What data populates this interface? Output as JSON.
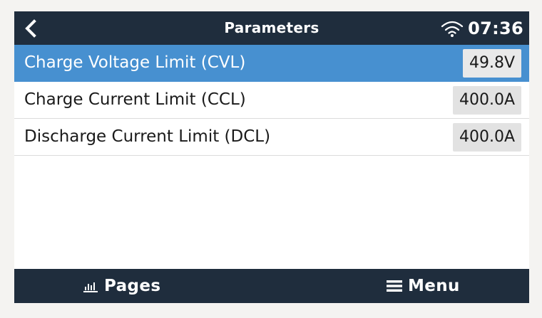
{
  "header": {
    "title": "Parameters",
    "time": "07:36",
    "icons": [
      "back-chevron-icon",
      "wifi-icon"
    ]
  },
  "parameters": [
    {
      "label": "Charge Voltage Limit (CVL)",
      "value": "49.8V",
      "selected": true
    },
    {
      "label": "Charge Current Limit (CCL)",
      "value": "400.0A",
      "selected": false
    },
    {
      "label": "Discharge Current Limit (DCL)",
      "value": "400.0A",
      "selected": false
    }
  ],
  "footer": {
    "pages_label": "Pages",
    "menu_label": "Menu",
    "icons": [
      "bar-chart-icon",
      "hamburger-menu-icon"
    ]
  },
  "colors": {
    "header_bg": "#1f2d3d",
    "selected_row": "#4790d0",
    "value_box": "#e2e2e2",
    "page_bg": "#f4f3f1"
  }
}
